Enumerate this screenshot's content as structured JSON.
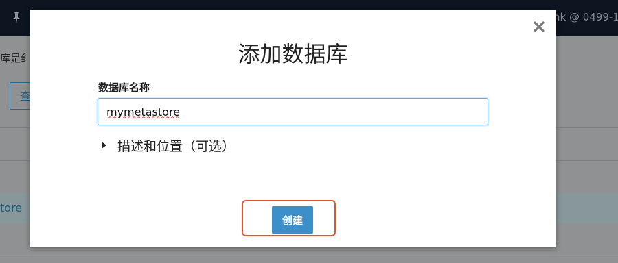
{
  "background": {
    "user_text": "nk @ 0499-1",
    "partial_text": "库是纟",
    "button_label": "查",
    "link_text": "tore"
  },
  "modal": {
    "title": "添加数据库",
    "close_icon": "close-icon",
    "name_label": "数据库名称",
    "name_value": "mymetastore",
    "disclosure_label": "描述和位置（可选）",
    "disclosure_icon": "caret-right-icon",
    "create_label": "创建"
  },
  "colors": {
    "accent": "#3d8fc9",
    "highlight": "#e8512a",
    "focus": "#66a9e0"
  }
}
